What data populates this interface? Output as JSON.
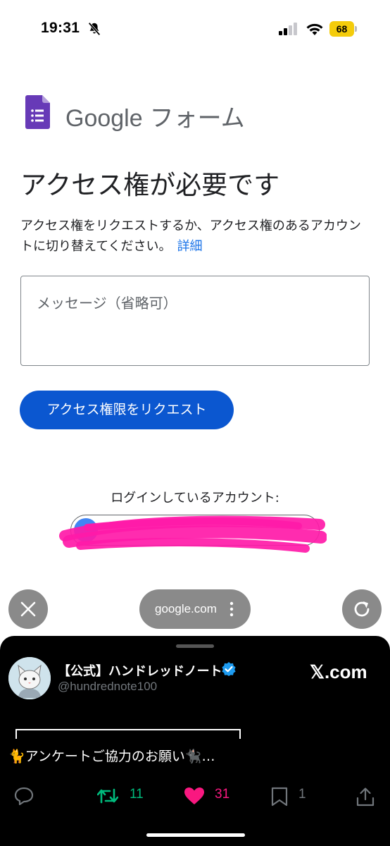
{
  "status_bar": {
    "time": "19:31",
    "battery_level": "68",
    "battery_color": "#f4cc0b",
    "icons": [
      "bell-slash-icon",
      "cellular-signal-icon",
      "wifi-icon",
      "battery-icon"
    ]
  },
  "header": {
    "brand": "Google",
    "product": "フォーム",
    "logo_color": "#673ab7"
  },
  "main": {
    "title": "アクセス権が必要です",
    "description": "アクセス権をリクエストするか、アクセス権のあるアカウントに切り替えてください。",
    "details_link": "詳細",
    "message_placeholder": "メッセージ（省略可）",
    "request_button": "アクセス権限をリクエスト",
    "logged_in_label": "ログインしているアカウント:",
    "accent_color": "#0b57d0",
    "redaction_color": "#ff1aa8"
  },
  "browser": {
    "url": "google.com",
    "icons": [
      "close-icon",
      "more-vert-icon",
      "reload-icon"
    ]
  },
  "x_panel": {
    "account_name": "【公式】ハンドレッドノート",
    "handle": "@hundrednote100",
    "domain": "𝕏.com",
    "tweet_text": "🐈アンケートご協力のお願い🐈‍⬛…",
    "actions": {
      "retweets": "11",
      "likes": "31",
      "bookmarks": "1"
    },
    "retweet_color": "#00ba7c",
    "like_color": "#f91880",
    "verified_color": "#1d9bf0"
  }
}
